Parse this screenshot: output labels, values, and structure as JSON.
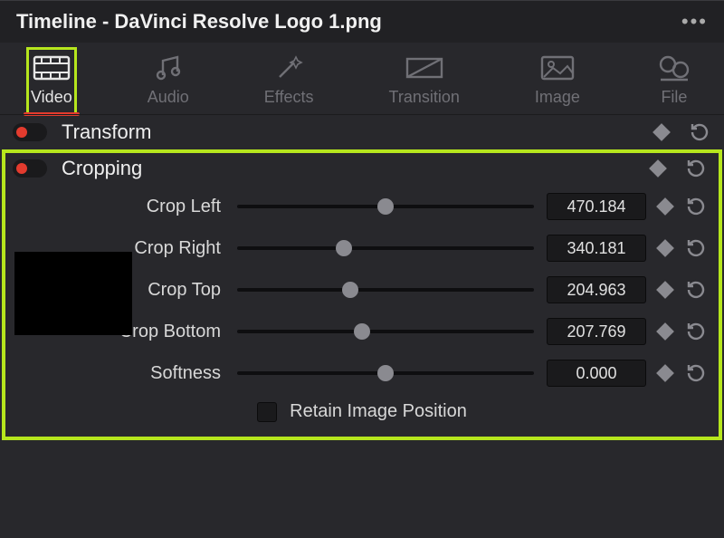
{
  "title": "Timeline - DaVinci Resolve Logo 1.png",
  "tabs": {
    "video": "Video",
    "audio": "Audio",
    "effects": "Effects",
    "transition": "Transition",
    "image": "Image",
    "file": "File",
    "active": "video"
  },
  "sections": {
    "transform": "Transform",
    "cropping": "Cropping"
  },
  "params": {
    "crop_left": {
      "label": "Crop Left",
      "value": "470.184",
      "pos": 0.5
    },
    "crop_right": {
      "label": "Crop Right",
      "value": "340.181",
      "pos": 0.36
    },
    "crop_top": {
      "label": "Crop Top",
      "value": "204.963",
      "pos": 0.38
    },
    "crop_bottom": {
      "label": "Crop Bottom",
      "value": "207.769",
      "pos": 0.42
    },
    "softness": {
      "label": "Softness",
      "value": "0.000",
      "pos": 0.5
    }
  },
  "retain_label": "Retain Image Position",
  "colors": {
    "accent": "#e33b2e",
    "highlight": "#b6e61d"
  }
}
